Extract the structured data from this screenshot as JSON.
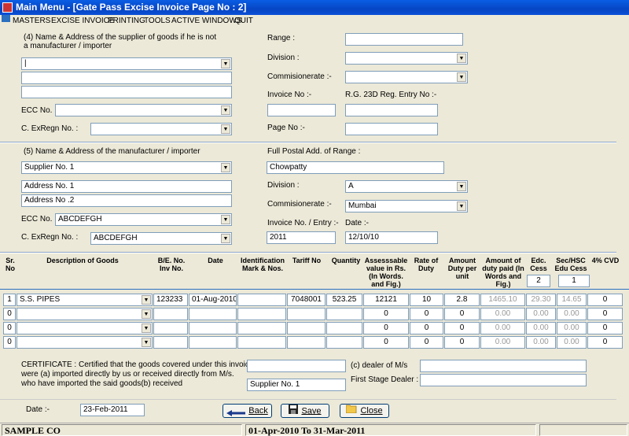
{
  "window": {
    "title": "Main Menu - [Gate Pass Excise Invoice Page No : 2]"
  },
  "menu": {
    "items": [
      "MASTERS",
      "EXCISE INVOICE",
      "PRINTING",
      "TOOLS",
      "ACTIVE WINDOWS",
      "QUIT"
    ]
  },
  "supplier": {
    "heading_line1": "(4) Name & Address of the supplier of goods if he is not",
    "heading_line2": "a manufacturer / importer",
    "name": "|",
    "address1": "",
    "address2": "",
    "ecc_label": "ECC No. :",
    "ecc_value": "",
    "cexregn_label": "C. ExRegn No. :",
    "cexregn_value": "",
    "range_label": "Range :",
    "range_value": "",
    "division_label": "Division :",
    "division_value": "",
    "commissionerate_label": "Commisionerate :-",
    "commissionerate_value": "",
    "invoice_label": "Invoice No :-",
    "invoice_value": "",
    "rg23d_label": "R.G. 23D Reg. Entry No :-",
    "rg23d_value": "",
    "pageno_label": "Page No :-",
    "pageno_value": ""
  },
  "manufacturer": {
    "heading": "(5) Name & Address of the manufacturer / importer",
    "name": "Supplier No. 1",
    "address1": "Address No. 1",
    "address2": "Address No .2",
    "ecc_label": "ECC No. :",
    "ecc_value": "ABCDEFGH",
    "cexregn_label": "C. ExRegn No. :",
    "cexregn_value": "ABCDEFGH",
    "postal_label": "Full Postal Add. of Range :",
    "postal_value": "Chowpatty",
    "division_label": "Division :",
    "division_value": "A",
    "commissionerate_label": "Commisionerate :-",
    "commissionerate_value": "Mumbai",
    "invoice_label": "Invoice No. / Entry :-",
    "invoice_value": "2011",
    "date_label": "Date :-",
    "date_value": "12/10/10"
  },
  "grid": {
    "headers": {
      "sr": "Sr. No",
      "desc": "Description of Goods",
      "be": "B/E. No. Inv No.",
      "date": "Date",
      "ident": "Identification Mark & Nos.",
      "tariff": "Tariff No",
      "qty": "Quantity",
      "assess": "Assesssable value in Rs. (In Words. and Fig.)",
      "rate": "Rate of Duty",
      "amt": "Amount Duty per unit",
      "paid": "Amount of duty paid (In Words and Fig.)",
      "edc": "Edc. Cess",
      "sec": "Sec/HSC Edu Cess",
      "cvd": "4% CVD"
    },
    "edc_rate": "2",
    "sec_rate": "1",
    "rows": [
      {
        "sr": "1",
        "desc": "S.S. PIPES",
        "be": "123233",
        "date": "01-Aug-2010",
        "ident": "",
        "tariff": "7048001",
        "qty": "523.25",
        "assess": "12121",
        "rate": "10",
        "amt": "2.8",
        "paid": "1465.10",
        "edc": "29.30",
        "sec": "14.65",
        "cvd": "0"
      },
      {
        "sr": "0",
        "desc": "",
        "be": "",
        "date": "",
        "ident": "",
        "tariff": "",
        "qty": "",
        "assess": "0",
        "rate": "0",
        "amt": "0",
        "paid": "0.00",
        "edc": "0.00",
        "sec": "0.00",
        "cvd": "0"
      },
      {
        "sr": "0",
        "desc": "",
        "be": "",
        "date": "",
        "ident": "",
        "tariff": "",
        "qty": "",
        "assess": "0",
        "rate": "0",
        "amt": "0",
        "paid": "0.00",
        "edc": "0.00",
        "sec": "0.00",
        "cvd": "0"
      },
      {
        "sr": "0",
        "desc": "",
        "be": "",
        "date": "",
        "ident": "",
        "tariff": "",
        "qty": "",
        "assess": "0",
        "rate": "0",
        "amt": "0",
        "paid": "0.00",
        "edc": "0.00",
        "sec": "0.00",
        "cvd": "0"
      }
    ]
  },
  "certificate": {
    "line1": "CERTIFICATE : Certified that the goods covered under this invoice",
    "line2": "were (a) imported directly by us or received directly from M/s.",
    "line3": "who have imported the said goods(b) received",
    "field1": "",
    "field2": "Supplier No. 1",
    "dealer_label": "(c) dealer of M/s",
    "dealer_value": "",
    "first_stage_label": "First Stage Dealer :",
    "first_stage_value": ""
  },
  "footer": {
    "date_label": "Date :-",
    "date_value": "23-Feb-2011",
    "back": "Back",
    "save": "Save",
    "close": "Close"
  },
  "status": {
    "company": "SAMPLE CO",
    "period": "01-Apr-2010 To 31-Mar-2011"
  }
}
